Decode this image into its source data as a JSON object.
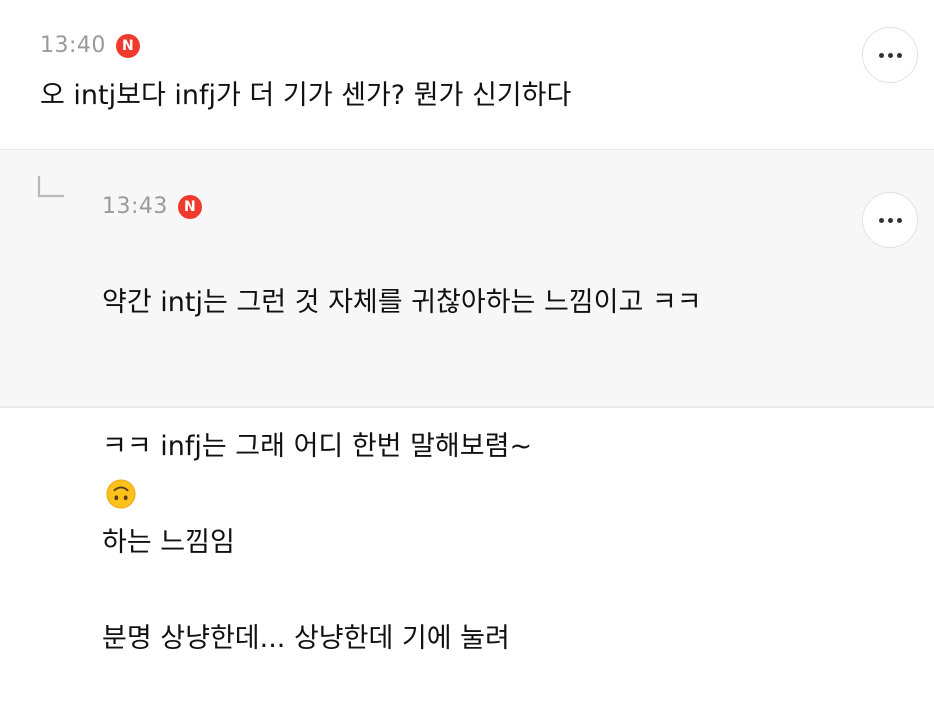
{
  "comments": [
    {
      "time": "13:40",
      "badge": "N",
      "text": "오 intj보다 infj가 더 기가 센가? 뭔가 신기하다",
      "more_icon": "more-horizontal-icon"
    },
    {
      "is_reply": true,
      "reply_icon": "reply-arrow-icon",
      "time": "13:43",
      "badge": "N",
      "text_line1": "약간 intj는 그런 것 자체를 귀찮아하는 느낌이고 ㅋㅋ",
      "text_line2_a": "ㅋㅋ infj는 그래 어디 한번 말해보렴~",
      "emoji": "upside-down-face-emoji",
      "text_line2_b": "하는 느낌임",
      "text_line3": "분명 상냥한데... 상냥한데 기에 눌려",
      "more_icon": "more-horizontal-icon"
    }
  ],
  "colors": {
    "badge": "#f03a2e",
    "time": "#9a9a9a",
    "reply_background": "#f7f7f7",
    "divider": "#e9e9e9"
  }
}
